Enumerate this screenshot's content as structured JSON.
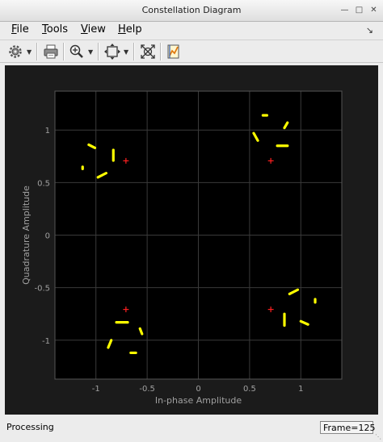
{
  "window": {
    "title": "Constellation Diagram"
  },
  "menu": [
    {
      "label": "File",
      "mnemonic": "F",
      "rest": "ile"
    },
    {
      "label": "Tools",
      "mnemonic": "T",
      "rest": "ools"
    },
    {
      "label": "View",
      "mnemonic": "V",
      "rest": "iew"
    },
    {
      "label": "Help",
      "mnemonic": "H",
      "rest": "elp"
    }
  ],
  "toolbar": {
    "icons": [
      "settings-gear-icon",
      "print-icon",
      "zoom-in-icon",
      "autoscale-icon",
      "fit-icon",
      "highlight-icon"
    ]
  },
  "chart_data": {
    "type": "scatter",
    "xlabel": "In-phase Amplitude",
    "ylabel": "Quadrature Amplitude",
    "xlim": [
      -1.4,
      1.4
    ],
    "ylim": [
      -1.37,
      1.37
    ],
    "xticks": [
      -1,
      -0.5,
      0,
      0.5,
      1
    ],
    "xticklabels": [
      "-1",
      "-0.5",
      "0",
      "0.5",
      "1"
    ],
    "yticks": [
      1,
      0.5,
      0,
      -0.5,
      -1
    ],
    "yticklabels": [
      "1",
      "0.5",
      "0",
      "-0.5",
      "-1"
    ],
    "grid": true,
    "background": "#1b1b1b",
    "axes_background": "#000000",
    "grid_color": "#3a3a3a",
    "axis_text_color": "#a0a0a0",
    "series": [
      {
        "color": "#ffff00",
        "marker": "dot-trail",
        "segments": [
          [
            [
              -1.13,
              0.65
            ],
            [
              -1.13,
              0.63
            ]
          ],
          [
            [
              -1.07,
              0.86
            ],
            [
              -1.01,
              0.83
            ]
          ],
          [
            [
              -0.98,
              0.55
            ],
            [
              -0.9,
              0.59
            ]
          ],
          [
            [
              -0.83,
              0.81
            ],
            [
              -0.83,
              0.71
            ]
          ],
          [
            [
              0.63,
              1.14
            ],
            [
              0.67,
              1.14
            ]
          ],
          [
            [
              0.54,
              0.97
            ],
            [
              0.58,
              0.9
            ]
          ],
          [
            [
              0.77,
              0.85
            ],
            [
              0.87,
              0.85
            ]
          ],
          [
            [
              0.84,
              1.02
            ],
            [
              0.87,
              1.07
            ]
          ],
          [
            [
              -0.88,
              -1.07
            ],
            [
              -0.85,
              -1.0
            ]
          ],
          [
            [
              -0.8,
              -0.83
            ],
            [
              -0.69,
              -0.83
            ]
          ],
          [
            [
              -0.66,
              -1.12
            ],
            [
              -0.61,
              -1.12
            ]
          ],
          [
            [
              -0.57,
              -0.89
            ],
            [
              -0.55,
              -0.94
            ]
          ],
          [
            [
              0.84,
              -0.75
            ],
            [
              0.84,
              -0.86
            ]
          ],
          [
            [
              0.89,
              -0.56
            ],
            [
              0.97,
              -0.52
            ]
          ],
          [
            [
              1.0,
              -0.82
            ],
            [
              1.07,
              -0.85
            ]
          ],
          [
            [
              1.14,
              -0.61
            ],
            [
              1.14,
              -0.64
            ]
          ]
        ]
      },
      {
        "color": "#ff2020",
        "marker": "plus",
        "points": [
          [
            -0.707,
            0.707
          ],
          [
            0.707,
            0.707
          ],
          [
            -0.707,
            -0.707
          ],
          [
            0.707,
            -0.707
          ]
        ]
      }
    ]
  },
  "status": {
    "left": "Processing",
    "frame": "Frame=125"
  }
}
